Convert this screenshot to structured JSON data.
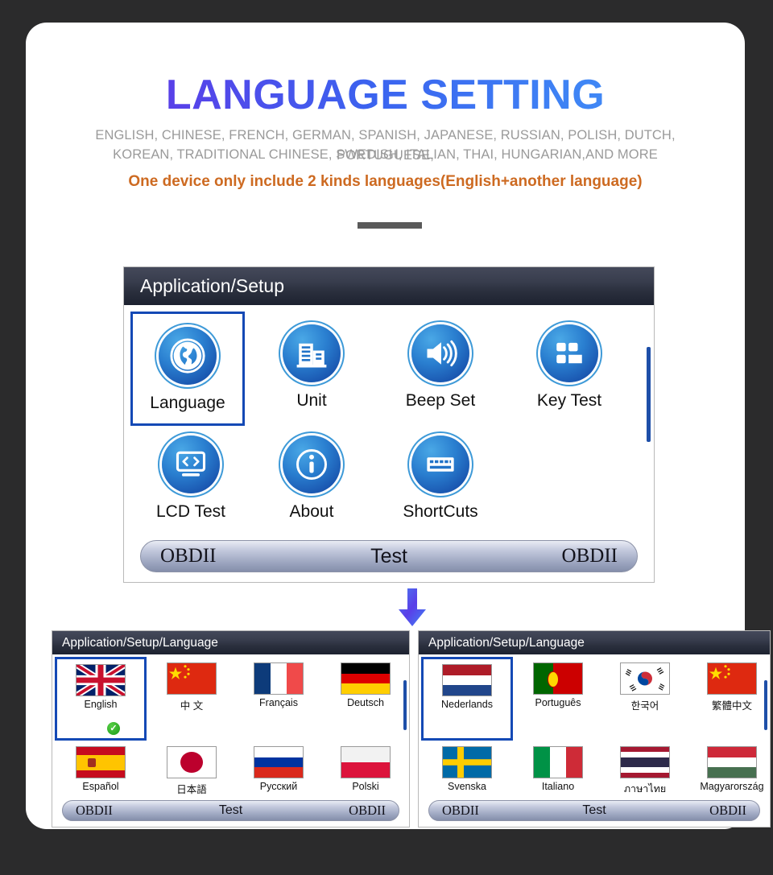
{
  "header": {
    "title": "LANGUAGE SETTING",
    "subtitle_line1": "ENGLISH, CHINESE, FRENCH, GERMAN, SPANISH, JAPANESE, RUSSIAN, POLISH, DUTCH, PORTUGUESE,",
    "subtitle_line2": "KOREAN, TRADITIONAL CHINESE, SWEDISH, ITALIAN, THAI, HUNGARIAN,AND MORE",
    "note": "One device only include 2 kinds languages(English+another language)",
    "title_gradient_from": "#6b33e0",
    "title_gradient_to": "#4a90f7",
    "note_color": "#cd6a21",
    "subtitle_color": "#9a9a9a"
  },
  "setup_screen": {
    "breadcrumb": "Application/Setup",
    "items": [
      {
        "label": "Language",
        "icon": "globe-icon",
        "selected": true
      },
      {
        "label": "Unit",
        "icon": "buildings-icon",
        "selected": false
      },
      {
        "label": "Beep Set",
        "icon": "speaker-icon",
        "selected": false
      },
      {
        "label": "Key Test",
        "icon": "keypad-icon",
        "selected": false
      },
      {
        "label": "LCD Test",
        "icon": "code-screen-icon",
        "selected": false
      },
      {
        "label": "About",
        "icon": "info-icon",
        "selected": false
      },
      {
        "label": "ShortCuts",
        "icon": "keyboard-icon",
        "selected": false
      }
    ],
    "footer": {
      "left": "OBDII",
      "center": "Test",
      "right": "OBDII"
    }
  },
  "language_screen_left": {
    "breadcrumb": "Application/Setup/Language",
    "items": [
      {
        "label": "English",
        "flag": "uk-flag",
        "selected": true,
        "checked": true
      },
      {
        "label": "中 文",
        "flag": "china-flag",
        "selected": false,
        "checked": false
      },
      {
        "label": "Français",
        "flag": "france-flag",
        "selected": false,
        "checked": false
      },
      {
        "label": "Deutsch",
        "flag": "germany-flag",
        "selected": false,
        "checked": false
      },
      {
        "label": "Español",
        "flag": "spain-flag",
        "selected": false,
        "checked": false
      },
      {
        "label": "日本語",
        "flag": "japan-flag",
        "selected": false,
        "checked": false
      },
      {
        "label": "Русский",
        "flag": "russia-flag",
        "selected": false,
        "checked": false
      },
      {
        "label": "Polski",
        "flag": "poland-flag",
        "selected": false,
        "checked": false
      }
    ],
    "footer": {
      "left": "OBDII",
      "center": "Test",
      "right": "OBDII"
    }
  },
  "language_screen_right": {
    "breadcrumb": "Application/Setup/Language",
    "items": [
      {
        "label": "Nederlands",
        "flag": "netherlands-flag",
        "selected": true,
        "checked": false
      },
      {
        "label": "Português",
        "flag": "portugal-flag",
        "selected": false,
        "checked": false
      },
      {
        "label": "한국어",
        "flag": "korea-flag",
        "selected": false,
        "checked": false
      },
      {
        "label": "繁體中文",
        "flag": "china-flag",
        "selected": false,
        "checked": false
      },
      {
        "label": "Svenska",
        "flag": "sweden-flag",
        "selected": false,
        "checked": false
      },
      {
        "label": "Italiano",
        "flag": "italy-flag",
        "selected": false,
        "checked": false
      },
      {
        "label": "ภาษาไทย",
        "flag": "thailand-flag",
        "selected": false,
        "checked": false
      },
      {
        "label": "Magyarország",
        "flag": "hungary-flag",
        "selected": false,
        "checked": false
      }
    ],
    "footer": {
      "left": "OBDII",
      "center": "Test",
      "right": "OBDII"
    }
  },
  "flow_arrow": {
    "icon": "arrow-down-icon",
    "color_from": "#3d7bf0",
    "color_to": "#6b33e0"
  }
}
